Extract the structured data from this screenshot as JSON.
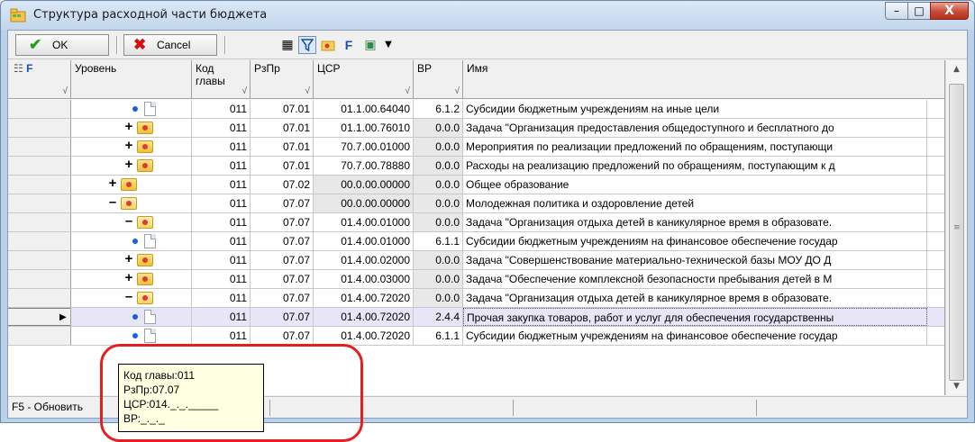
{
  "window": {
    "title": "Структура расходной части бюджета",
    "min_glyph": "–",
    "max_glyph": "□",
    "close_glyph": "X"
  },
  "toolbar": {
    "ok_label": "OK",
    "cancel_label": "Cancel",
    "icons": [
      "columns-icon",
      "filter-icon",
      "folder-icon",
      "formula-icon",
      "cube-icon",
      "dropdown-arrow-icon"
    ]
  },
  "grid": {
    "headers": {
      "indicator": "F",
      "level": "Уровень",
      "kod_line1": "Код",
      "kod_line2": "главы",
      "rzp": "РзПр",
      "csr": "ЦСР",
      "vr": "ВР",
      "name": "Имя"
    },
    "rows": [
      {
        "kod": "011",
        "rzp": "07.01",
        "csr": "01.1.00.64040",
        "vr": "6.1.2",
        "name": "Субсидии бюджетным учреждениям на иные цели"
      },
      {
        "kod": "011",
        "rzp": "07.01",
        "csr": "01.1.00.76010",
        "vr": "0.0.0",
        "name": "Задача \"Организация предоставления общедоступного и бесплатного до"
      },
      {
        "kod": "011",
        "rzp": "07.01",
        "csr": "70.7.00.01000",
        "vr": "0.0.0",
        "name": "Мероприятия по реализации  предложений по обращениям, поступающи"
      },
      {
        "kod": "011",
        "rzp": "07.01",
        "csr": "70.7.00.78880",
        "vr": "0.0.0",
        "name": "Расходы на реализацию предложений по обращениям, поступающим к д"
      },
      {
        "kod": "011",
        "rzp": "07.02",
        "csr": "00.0.00.00000",
        "vr": "0.0.0",
        "name": "Общее образование"
      },
      {
        "kod": "011",
        "rzp": "07.07",
        "csr": "00.0.00.00000",
        "vr": "0.0.0",
        "name": "Молодежная политика и оздоровление детей"
      },
      {
        "kod": "011",
        "rzp": "07.07",
        "csr": "01.4.00.01000",
        "vr": "0.0.0",
        "name": "Задача \"Организация отдыха детей в каникулярное время в образовате."
      },
      {
        "kod": "011",
        "rzp": "07.07",
        "csr": "01.4.00.01000",
        "vr": "6.1.1",
        "name": "Субсидии бюджетным учреждениям на финансовое обеспечение государ"
      },
      {
        "kod": "011",
        "rzp": "07.07",
        "csr": "01.4.00.02000",
        "vr": "0.0.0",
        "name": "Задача \"Совершенствование материально-технической базы МОУ ДО Д"
      },
      {
        "kod": "011",
        "rzp": "07.07",
        "csr": "01.4.00.03000",
        "vr": "0.0.0",
        "name": "Задача \"Обеспечение комплексной безопасности пребывания детей в М"
      },
      {
        "kod": "011",
        "rzp": "07.07",
        "csr": "01.4.00.72020",
        "vr": "0.0.0",
        "name": "Задача \"Организация отдыха детей в каникулярное время в образовате."
      },
      {
        "kod": "011",
        "rzp": "07.07",
        "csr": "01.4.00.72020",
        "vr": "2.4.4",
        "name": "Прочая закупка товаров, работ и услуг для обеспечения государственны"
      },
      {
        "kod": "011",
        "rzp": "07.07",
        "csr": "01.4.00.72020",
        "vr": "6.1.1",
        "name": "Субсидии бюджетным учреждениям на финансовое обеспечение государ"
      }
    ]
  },
  "status": {
    "text": "F5 - Обновить"
  },
  "tooltip": {
    "kod": "Код главы:011",
    "rzp": "РзПр:07.07",
    "csr": "ЦСР:014._._._____",
    "vr": "ВР:_._._"
  },
  "colors": {
    "annotation": "#e41f1f",
    "selected_row": "#e6e6f8",
    "tooltip_bg": "#ffffe1"
  }
}
